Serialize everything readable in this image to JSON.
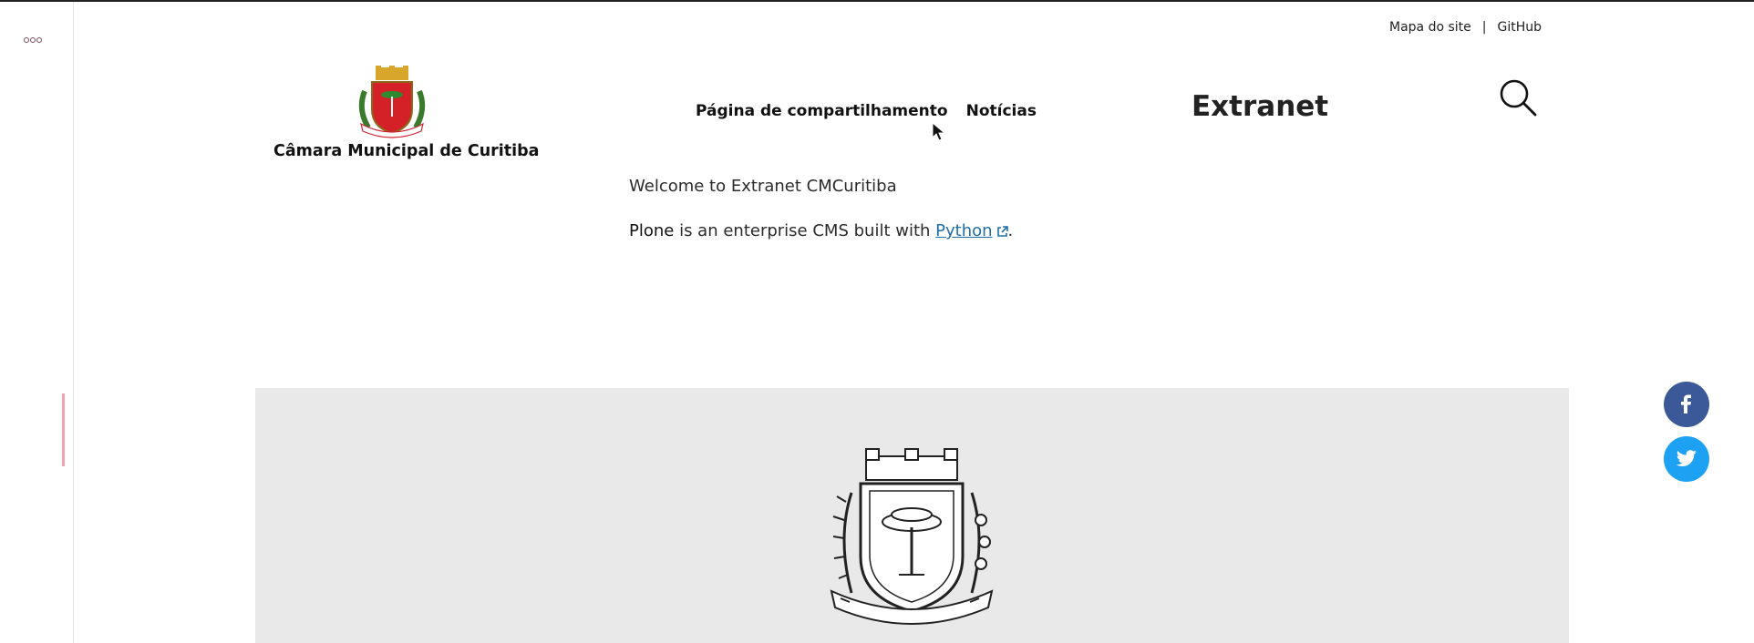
{
  "top_nav": {
    "sitemap": "Mapa do site",
    "separator": "|",
    "github": "GitHub"
  },
  "brand": {
    "site_name": "Câmara Municipal de Curitiba"
  },
  "main_nav": {
    "items": [
      "Página de compartilhamento",
      "Notícias"
    ]
  },
  "section_title": "Extranet",
  "content": {
    "welcome": "Welcome to Extranet CMCuritiba",
    "plone_word": "Plone",
    "plone_text": " is an enterprise CMS built with ",
    "python_link": "Python",
    "period": "."
  },
  "icons": {
    "toolbar": "more-icon",
    "search": "search-icon",
    "external": "external-link-icon",
    "facebook": "facebook-icon",
    "twitter": "twitter-icon"
  },
  "colors": {
    "facebook": "#3b5998",
    "twitter": "#1da1f2",
    "link": "#1f6ea8",
    "banner_bg": "#e9e9e9",
    "toolbar_accent": "#f4a3ac"
  }
}
